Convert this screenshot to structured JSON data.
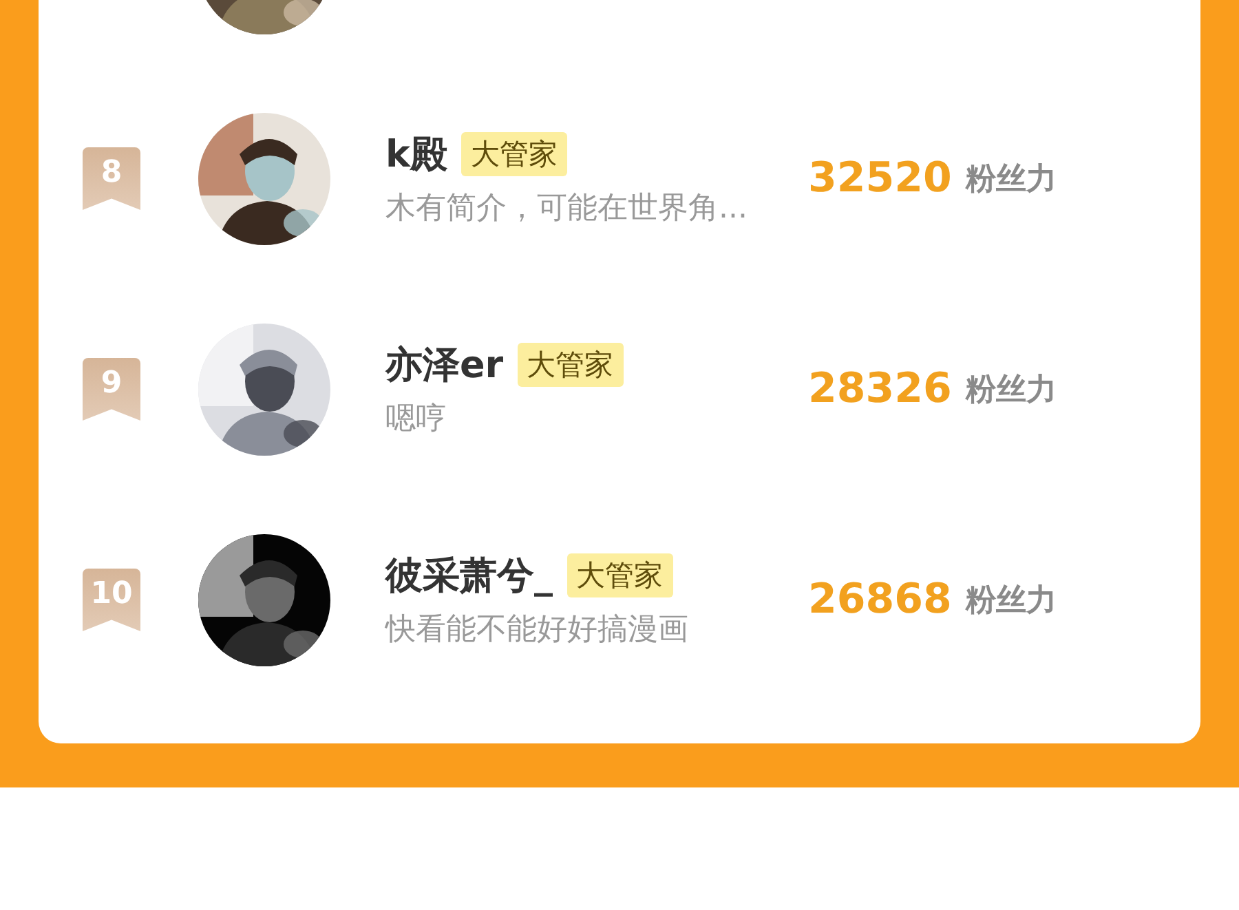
{
  "ranking": [
    {
      "kind": "partial"
    },
    {
      "kind": "full",
      "rank": "8",
      "name": "k殿",
      "badge": "大管家",
      "description": "木有简介，可能在世界角...",
      "score": "32520",
      "unit": "粉丝力"
    },
    {
      "kind": "full",
      "rank": "9",
      "name": "亦泽er",
      "badge": "大管家",
      "description": "嗯哼",
      "score": "28326",
      "unit": "粉丝力"
    },
    {
      "kind": "full",
      "rank": "10",
      "name": "彼采萧兮_",
      "badge": "大管家",
      "description": "快看能不能好好搞漫画",
      "score": "26868",
      "unit": "粉丝力"
    }
  ]
}
